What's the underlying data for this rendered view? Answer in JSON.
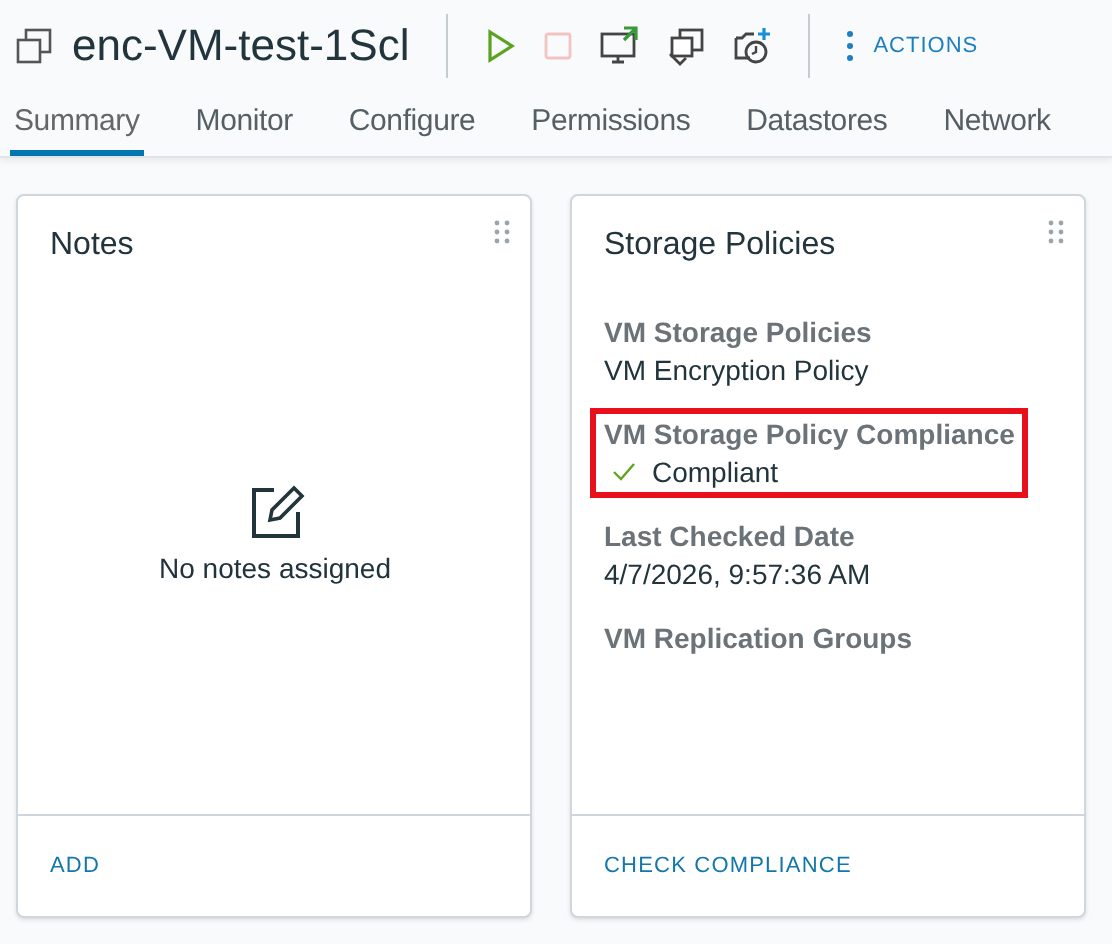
{
  "header": {
    "title": "enc-VM-test-1Scl",
    "toolbar": [
      {
        "kind": "power-on",
        "disabled": false
      },
      {
        "kind": "power-off",
        "disabled": true
      },
      {
        "kind": "console",
        "disabled": false
      },
      {
        "kind": "migrate",
        "disabled": false
      },
      {
        "kind": "snapshot",
        "disabled": false
      }
    ],
    "actions_label": "ACTIONS"
  },
  "tabs": [
    {
      "label": "Summary",
      "selected": true
    },
    {
      "label": "Monitor",
      "selected": false
    },
    {
      "label": "Configure",
      "selected": false
    },
    {
      "label": "Permissions",
      "selected": false
    },
    {
      "label": "Datastores",
      "selected": false
    },
    {
      "label": "Network",
      "selected": false
    }
  ],
  "cards": [
    {
      "kind": "notes",
      "title": "Notes",
      "empty_text": "No notes assigned",
      "footer_link": "ADD"
    },
    {
      "kind": "fields",
      "title": "Storage Policies",
      "fields": [
        {
          "label": "VM Storage Policies",
          "value": "VM Encryption Policy",
          "highlighted": false
        },
        {
          "label": "VM Storage Policy Compliance",
          "value": "Compliant",
          "kind": "check",
          "highlighted": true
        },
        {
          "label": "Last Checked Date",
          "value": "4/7/2026, 9:57:36 AM",
          "highlighted": false
        },
        {
          "label": "VM Replication Groups",
          "highlighted": false
        }
      ],
      "footer_link": "CHECK COMPLIANCE"
    }
  ]
}
